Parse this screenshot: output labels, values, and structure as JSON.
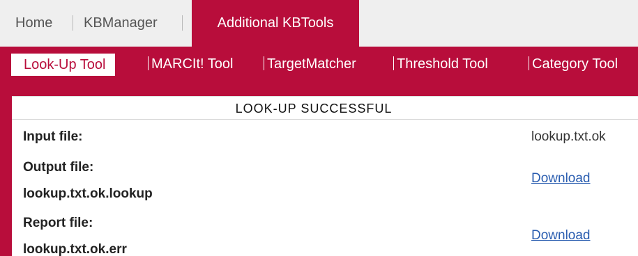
{
  "top_tabs": {
    "home": "Home",
    "kbmanager": "KBManager",
    "additional": "Additional KBTools"
  },
  "sub_nav": {
    "items": [
      "Look-Up Tool",
      "MARCIt! Tool",
      "TargetMatcher",
      "Threshold Tool",
      "Category Tool"
    ]
  },
  "result": {
    "title": "LOOK-UP SUCCESSFUL",
    "input_label": "Input file:",
    "input_value": "lookup.txt.ok",
    "output_label": "Output file:",
    "output_filename": "lookup.txt.ok.lookup",
    "output_link": "Download",
    "report_label": "Report file:",
    "report_filename": "lookup.txt.ok.err",
    "report_link": "Download"
  },
  "colors": {
    "brand": "#b80d3b",
    "link": "#2a5db0"
  }
}
